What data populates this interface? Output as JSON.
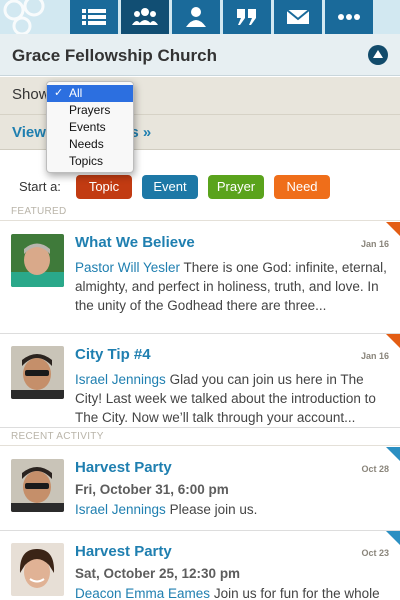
{
  "nav": {
    "tabs": [
      {
        "icon": "list-icon",
        "active": false
      },
      {
        "icon": "group-icon",
        "active": true
      },
      {
        "icon": "person-icon",
        "active": false
      },
      {
        "icon": "quote-icon",
        "active": false
      },
      {
        "icon": "envelope-icon",
        "active": false
      },
      {
        "icon": "more-icon",
        "active": false
      }
    ]
  },
  "header": {
    "title": "Grace Fellowship Church"
  },
  "filter": {
    "show_label": "Show",
    "options": [
      "All",
      "Prayers",
      "Events",
      "Needs",
      "Topics"
    ],
    "selected": "All"
  },
  "view_link": "View All Members »",
  "start": {
    "label": "Start a:",
    "buttons": [
      {
        "label": "Topic",
        "color": "#c23b12"
      },
      {
        "label": "Event",
        "color": "#1d78a6"
      },
      {
        "label": "Prayer",
        "color": "#5aa31c"
      },
      {
        "label": "Need",
        "color": "#ef6e1a"
      }
    ]
  },
  "sections": {
    "featured": "FEATURED",
    "recent": "RECENT ACTIVITY"
  },
  "featured_items": [
    {
      "title": "What We Believe",
      "date": "Jan 16",
      "author": "Pastor Will Yesler",
      "text": " There is one God: infinite, eternal, almighty, and perfect in holiness, truth, and love. In the unity of the Godhead there are three..."
    },
    {
      "title": "City Tip #4",
      "date": "Jan 16",
      "author": "Israel Jennings",
      "text": " Glad you can join us here in The City! Last week we talked about the introduction to The City. Now we’ll talk through your account..."
    }
  ],
  "recent_items": [
    {
      "title": "Harvest Party",
      "date": "Oct 28",
      "subtitle": "Fri, October 31, 6:00 pm",
      "author": "Israel Jennings",
      "text": " Please join us."
    },
    {
      "title": "Harvest Party",
      "date": "Oct 23",
      "subtitle": "Sat, October 25, 12:30 pm",
      "author": "Deacon Emma Eames",
      "text": " Join us for fun for the whole"
    }
  ]
}
